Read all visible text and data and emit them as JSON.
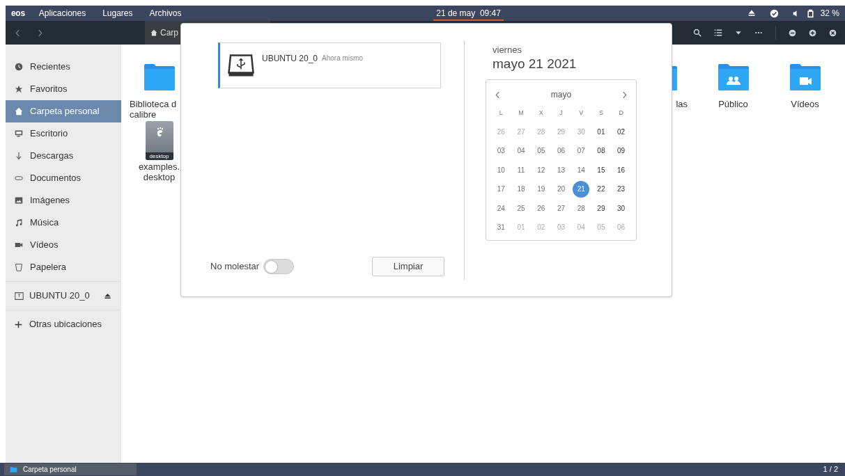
{
  "top_panel": {
    "logo": "eos",
    "menus": [
      "Aplicaciones",
      "Lugares",
      "Archivos"
    ],
    "clock": {
      "text": "21 de may  09:47",
      "active": true
    },
    "battery": "32 %"
  },
  "header": {
    "path": "Carp"
  },
  "sidebar": {
    "places": [
      {
        "label": "Recientes",
        "selected": false
      },
      {
        "label": "Favoritos",
        "selected": false
      },
      {
        "label": "Carpeta personal",
        "selected": true
      },
      {
        "label": "Escritorio",
        "selected": false
      },
      {
        "label": "Descargas",
        "selected": false
      },
      {
        "label": "Documentos",
        "selected": false
      },
      {
        "label": "Imágenes",
        "selected": false
      },
      {
        "label": "Música",
        "selected": false
      },
      {
        "label": "Vídeos",
        "selected": false
      },
      {
        "label": "Papelera",
        "selected": false
      }
    ],
    "devices": [
      {
        "label": "UBUNTU 20_0",
        "selected": false
      }
    ],
    "other": "Otras ubicaciones"
  },
  "files": [
    {
      "kind": "folder",
      "label": "Biblioteca d\ncalibre"
    },
    {
      "kind": "folder-template",
      "label": "las"
    },
    {
      "kind": "folder-people",
      "label": "Público"
    },
    {
      "kind": "folder-video",
      "label": "Vídeos"
    },
    {
      "kind": "desktop-file",
      "badge": "desktop",
      "label": "examples.\ndesktop"
    }
  ],
  "notifications": [
    {
      "title": "UBUNTU 20_0",
      "time": "Ahora mismo"
    }
  ],
  "do_not_disturb": {
    "label": "No molestar",
    "on": false
  },
  "clear_button": "Limpiar",
  "date": {
    "weekday": "viernes",
    "full": "mayo 21 2021"
  },
  "calendar": {
    "month": "mayo",
    "weekdays": [
      "L",
      "M",
      "X",
      "J",
      "V",
      "S",
      "D"
    ],
    "weeks": [
      [
        {
          "d": "26",
          "other": true,
          "selected": false
        },
        {
          "d": "27",
          "other": true,
          "selected": false
        },
        {
          "d": "28",
          "other": true,
          "selected": false
        },
        {
          "d": "29",
          "other": true,
          "selected": false
        },
        {
          "d": "30",
          "other": true,
          "selected": false
        },
        {
          "d": "01",
          "other": false,
          "selected": false
        },
        {
          "d": "02",
          "other": false,
          "selected": false
        }
      ],
      [
        {
          "d": "03",
          "other": false,
          "selected": false
        },
        {
          "d": "04",
          "other": false,
          "selected": false
        },
        {
          "d": "05",
          "other": false,
          "selected": false
        },
        {
          "d": "06",
          "other": false,
          "selected": false
        },
        {
          "d": "07",
          "other": false,
          "selected": false
        },
        {
          "d": "08",
          "other": false,
          "selected": false
        },
        {
          "d": "09",
          "other": false,
          "selected": false
        }
      ],
      [
        {
          "d": "10",
          "other": false,
          "selected": false
        },
        {
          "d": "11",
          "other": false,
          "selected": false
        },
        {
          "d": "12",
          "other": false,
          "selected": false
        },
        {
          "d": "13",
          "other": false,
          "selected": false
        },
        {
          "d": "14",
          "other": false,
          "selected": false
        },
        {
          "d": "15",
          "other": false,
          "selected": false
        },
        {
          "d": "16",
          "other": false,
          "selected": false
        }
      ],
      [
        {
          "d": "17",
          "other": false,
          "selected": false
        },
        {
          "d": "18",
          "other": false,
          "selected": false
        },
        {
          "d": "19",
          "other": false,
          "selected": false
        },
        {
          "d": "20",
          "other": false,
          "selected": false
        },
        {
          "d": "21",
          "other": false,
          "selected": true
        },
        {
          "d": "22",
          "other": false,
          "selected": false
        },
        {
          "d": "23",
          "other": false,
          "selected": false
        }
      ],
      [
        {
          "d": "24",
          "other": false,
          "selected": false
        },
        {
          "d": "25",
          "other": false,
          "selected": false
        },
        {
          "d": "26",
          "other": false,
          "selected": false
        },
        {
          "d": "27",
          "other": false,
          "selected": false
        },
        {
          "d": "28",
          "other": false,
          "selected": false
        },
        {
          "d": "29",
          "other": false,
          "selected": false
        },
        {
          "d": "30",
          "other": false,
          "selected": false
        }
      ],
      [
        {
          "d": "31",
          "other": false,
          "selected": false
        },
        {
          "d": "01",
          "other": true,
          "selected": false
        },
        {
          "d": "02",
          "other": true,
          "selected": false
        },
        {
          "d": "03",
          "other": true,
          "selected": false
        },
        {
          "d": "04",
          "other": true,
          "selected": false
        },
        {
          "d": "05",
          "other": true,
          "selected": false
        },
        {
          "d": "06",
          "other": true,
          "selected": false
        }
      ]
    ]
  },
  "taskbar": {
    "window": "Carpeta personal",
    "workspace": "1 / 2"
  }
}
